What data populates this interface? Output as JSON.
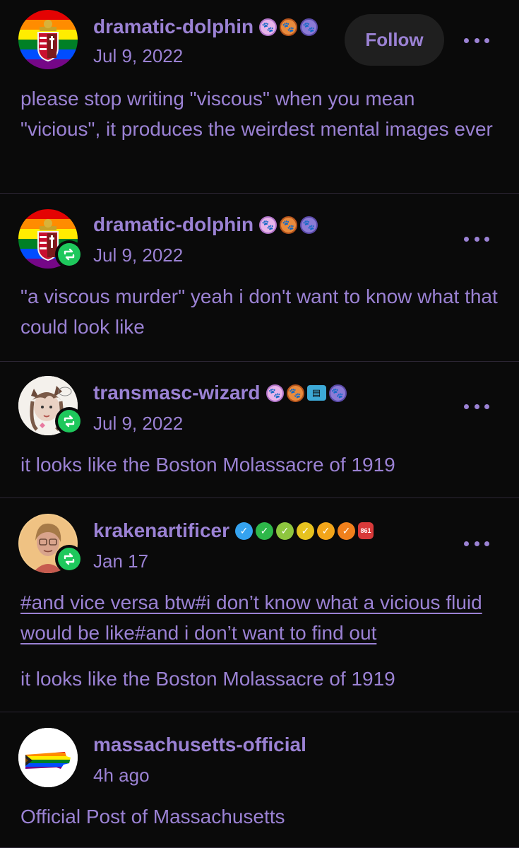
{
  "posts": [
    {
      "username": "dramatic-dolphin",
      "date": "Jul 9, 2022",
      "follow_label": "Follow",
      "body": "please stop writing \"viscous\" when you mean \"vicious\", it produces the weirdest mental images ever",
      "badges": [
        "paw-badge-pink",
        "paw-badge-orange",
        "paw-badge-purple"
      ]
    },
    {
      "username": "dramatic-dolphin",
      "date": "Jul 9, 2022",
      "reblog": true,
      "body": "\"a viscous murder\" yeah i don't want to know what that could look like",
      "badges": [
        "paw-badge-pink",
        "paw-badge-orange",
        "paw-badge-purple"
      ]
    },
    {
      "username": "transmasc-wizard",
      "date": "Jul 9, 2022",
      "reblog": true,
      "body": "it looks like the Boston Molassacre of 1919",
      "badges": [
        "paw-badge-pink",
        "paw-badge-orange",
        "robot-badge",
        "paw-badge-purple"
      ]
    },
    {
      "username": "krakenartificer",
      "date": "Jan 17",
      "reblog": true,
      "tags": "#and vice versa btw#i don’t know what a vicious fluid would be like#and i don’t want to find out",
      "body": "it looks like the Boston Molassacre of 1919",
      "badges": [
        "check-badge-blue",
        "check-badge-green",
        "check-badge-lime",
        "check-badge-yellow",
        "check-badge-amber",
        "check-badge-orange",
        "counter-badge"
      ],
      "counter_badge_text": "861"
    },
    {
      "username": "massachusetts-official",
      "date": "4h ago",
      "body": "Official Post of Massachusetts"
    }
  ],
  "colors": {
    "background": "#0a0a0a",
    "text": "#9b82d4",
    "divider": "#2b2533",
    "reblog_green": "#1ec85c",
    "follow_bg": "#1f1f1f"
  }
}
